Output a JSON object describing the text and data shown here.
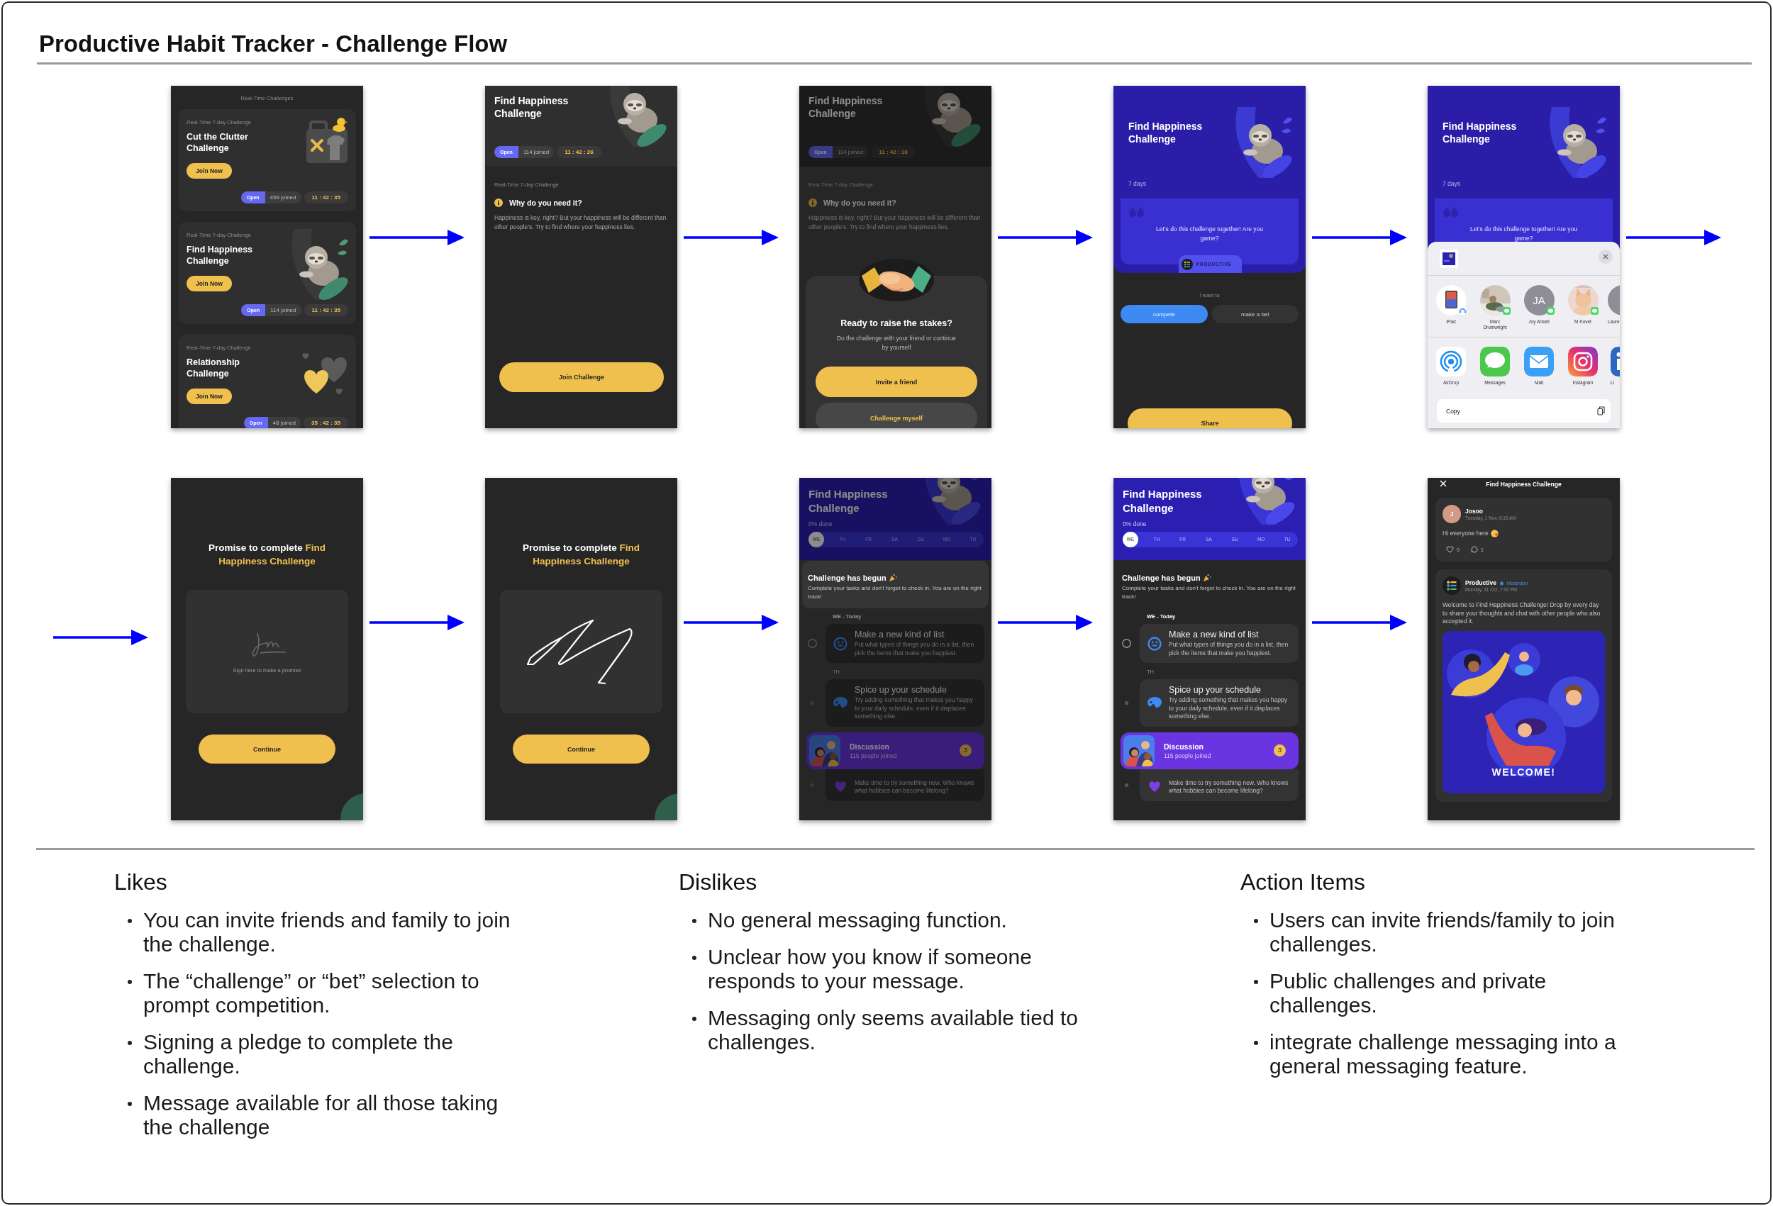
{
  "title": "Productive Habit Tracker - Challenge Flow",
  "flow": [
    {
      "kind": "challenge_list",
      "header": "Real-Time Challenges",
      "cards": [
        {
          "eyebrow": "Real-Time 7-day Challenge",
          "title": "Cut the Clutter Challenge",
          "button": "Join Now",
          "status": "Open",
          "joined": "459 joined",
          "timer": "11 : 42 : 35",
          "kind": "box"
        },
        {
          "eyebrow": "Real-Time 7-day Challenge",
          "title": "Find Happiness Challenge",
          "button": "Join Now",
          "status": "Open",
          "joined": "114 joined",
          "timer": "11 : 42 : 35",
          "kind": "sloth"
        },
        {
          "eyebrow": "Real-Time 7-day Challenge",
          "title": "Relationship Challenge",
          "button": "Join Now",
          "status": "Open",
          "joined": "48 joined",
          "timer": "35 : 42 : 35",
          "kind": "hearts"
        }
      ]
    },
    {
      "kind": "challenge_detail",
      "title": "Find Happiness Challenge",
      "status": "Open",
      "joined": "114 joined",
      "timer": "11 : 42 : 26",
      "eyebrow": "Real-Time 7-day Challenge",
      "question": "Why do you need it?",
      "body": "Happiness is key, right? But your happiness will be different than other people's. Try to find where your happiness lies.",
      "button": "Join Challenge"
    },
    {
      "kind": "challenge_detail",
      "title": "Find Happiness Challenge",
      "status": "Open",
      "joined": "114 joined",
      "timer": "11 : 42 : 18",
      "eyebrow": "Real-Time 7-day Challenge",
      "question": "Why do you need it?",
      "body": "Happiness is key, right? But your happiness will be different than other people's. Try to find where your happiness lies.",
      "dialog": {
        "title": "Ready to raise the stakes?",
        "text": "Do the challenge with your friend or continue by yourself",
        "primary": "Invite a friend",
        "secondary": "Challenge myself"
      }
    },
    {
      "kind": "share_setup",
      "title": "Find Happiness Challenge",
      "duration": "7 days",
      "quote": "Let’s do this challenge together! Are you game?",
      "tag": "PRODUCTIVE",
      "prompt": "I want to",
      "options": [
        {
          "label": "compete",
          "selected": true
        },
        {
          "label": "make a bet",
          "selected": false
        }
      ],
      "button": "Share"
    },
    {
      "kind": "share_setup",
      "title": "Find Happiness Challenge",
      "duration": "7 days",
      "quote": "Let’s do this challenge together! Are you game?",
      "sheet": {
        "people": [
          {
            "name": "iPad",
            "kind": "device"
          },
          {
            "name": "Marc Drumwright"
          },
          {
            "name": "Joy Ansell",
            "kind": "initials",
            "initials": "JA"
          },
          {
            "name": "M Kuvet",
            "kind": "pet_photo"
          },
          {
            "name": "Laure",
            "kind": "blank"
          }
        ],
        "apps": [
          {
            "name": "AirDrop",
            "kind": "airdrop"
          },
          {
            "name": "Messages",
            "kind": "messages"
          },
          {
            "name": "Mail",
            "kind": "mail"
          },
          {
            "name": "Instagram",
            "kind": "camera"
          },
          {
            "name": "Li",
            "kind": "blue_tile"
          }
        ],
        "action": "Copy"
      }
    },
    {
      "kind": "signature",
      "title": "Promise to complete",
      "highlight": "Find Happiness Challenge",
      "signed": false,
      "placeholder": "Sign here to make a promise",
      "button": "Continue"
    },
    {
      "kind": "signature",
      "title": "Promise to complete",
      "highlight": "Find Happiness Challenge",
      "signed": true,
      "button": "Continue"
    },
    {
      "kind": "schedule",
      "dimmed": true,
      "title": "Find Happiness Challenge",
      "progress": "0% done",
      "days": [
        {
          "label": "WE",
          "selected": true
        },
        {
          "label": "TH",
          "selected": false
        },
        {
          "label": "FR",
          "selected": false
        },
        {
          "label": "SA",
          "selected": false
        },
        {
          "label": "SU",
          "selected": false
        },
        {
          "label": "MO",
          "selected": false
        },
        {
          "label": "TU",
          "selected": false
        }
      ],
      "banner": {
        "title": "Challenge has begun",
        "text": "Complete your tasks and don't forget to check in. You are on the right track!"
      },
      "groups": [
        {
          "label": "WE - Today",
          "today": true,
          "tasks": [
            {
              "title": "Make a new kind of list",
              "text": "Put what types of things you do in a list, then pick the items that make you happiest.",
              "kind": "smiley"
            }
          ]
        },
        {
          "label": "TH",
          "today": false,
          "tasks": [
            {
              "title": "Spice up your schedule",
              "text": "Try adding something that makes you happy to your daily schedule, even if it displaces something else.",
              "kind": "palette"
            }
          ]
        },
        {
          "today": false,
          "tasks": [
            {
              "text": "Make time to try something new. Who knows what hobbies can become lifelong?",
              "kind": "heart"
            }
          ]
        }
      ],
      "discussion": {
        "title": "Discussion",
        "members": "115 people joined",
        "count": "3"
      }
    },
    {
      "kind": "schedule",
      "dimmed": false,
      "title": "Find Happiness Challenge",
      "progress": "0% done",
      "days": [
        {
          "label": "WE",
          "selected": true
        },
        {
          "label": "TH",
          "selected": false
        },
        {
          "label": "FR",
          "selected": false
        },
        {
          "label": "SA",
          "selected": false
        },
        {
          "label": "SU",
          "selected": false
        },
        {
          "label": "MO",
          "selected": false
        },
        {
          "label": "TU",
          "selected": false
        }
      ],
      "banner": {
        "title": "Challenge has begun",
        "text": "Complete your tasks and don't forget to check in. You are on the right track!"
      },
      "groups": [
        {
          "label": "WE - Today",
          "today": true,
          "tasks": [
            {
              "title": "Make a new kind of list",
              "text": "Put what types of things you do in a list, then pick the items that make you happiest.",
              "kind": "smiley"
            }
          ]
        },
        {
          "label": "TH",
          "today": false,
          "tasks": [
            {
              "title": "Spice up your schedule",
              "text": "Try adding something that makes you happy to your daily schedule, even if it displaces something else.",
              "kind": "palette"
            }
          ]
        },
        {
          "today": false,
          "tasks": [
            {
              "text": "Make time to try something new. Who knows what hobbies can become lifelong?",
              "kind": "heart"
            }
          ]
        }
      ],
      "discussion": {
        "title": "Discussion",
        "members": "115 people joined",
        "count": "3"
      }
    },
    {
      "kind": "discussion",
      "title": "Find Happiness Challenge",
      "posts": [
        {
          "author": "Josoo",
          "kind": "initial",
          "initial": "J",
          "time": "Tuesday, 1 Nov, 6:15 AM",
          "text": "Hi everyone here",
          "emoji": true,
          "likes": "0",
          "comments": "1"
        },
        {
          "author": "Productive",
          "kind": "logo",
          "role": "Moderator",
          "time": "Monday, 31 Oct, 7:00 PM",
          "text": "Welcome to Find Happiness Challenge! Drop by every day to share your thoughts and chat with other people who also accepted it.",
          "image_caption": "WELCOME!"
        }
      ]
    }
  ],
  "notes": [
    {
      "heading": "Likes",
      "items": [
        "You can invite friends and family to join the challenge.",
        "The “challenge” or “bet” selection to prompt competition.",
        "Signing a pledge to complete the challenge.",
        "Message available for all those taking the challenge"
      ]
    },
    {
      "heading": "Dislikes",
      "items": [
        "No general messaging function.",
        "Unclear how you know if someone responds to your message.",
        "Messaging only seems available tied to challenges."
      ]
    },
    {
      "heading": "Action Items",
      "items": [
        "Users can invite friends/family to join challenges.",
        "Public challenges and private challenges.",
        "integrate challenge messaging into a general messaging feature."
      ]
    }
  ]
}
